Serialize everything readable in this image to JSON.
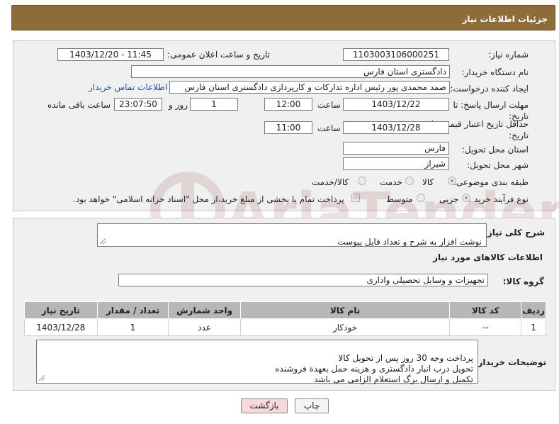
{
  "header": {
    "title": "جزئیات اطلاعات نیاز"
  },
  "form": {
    "need_number": {
      "label": "شماره نیاز:",
      "value": "1103003106000251"
    },
    "announce": {
      "label": "تاریخ و ساعت اعلان عمومی:",
      "value": "1403/12/20 - 11:45"
    },
    "buyer_org": {
      "label": "نام دستگاه خریدار:",
      "value": "دادگستری استان فارس"
    },
    "requester": {
      "label": "ایجاد کننده درخواست:",
      "value": "صمد محمدی پور رئیس اداره تدارکات و کارپردازی دادگستری استان فارس",
      "contact_link": "اطلاعات تماس خریدار"
    },
    "reply_deadline": {
      "label": "مهلت ارسال پاسخ: تا تاریخ:",
      "date": "1403/12/22",
      "time_label": "ساعت",
      "time": "12:00",
      "days": "1",
      "days_label": "روز و",
      "remaining": "23:07:50",
      "remaining_label": "ساعت باقی مانده"
    },
    "price_validity": {
      "label": "حداقل تاریخ اعتبار قیمت: تا تاریخ:",
      "date": "1403/12/28",
      "time_label": "ساعت",
      "time": "11:00"
    },
    "delivery_province": {
      "label": "استان محل تحویل:",
      "value": "فارس"
    },
    "delivery_city": {
      "label": "شهر محل تحویل:",
      "value": "شیراز"
    },
    "category": {
      "label": "طبقه بندی موضوعی:",
      "options": [
        "کالا",
        "خدمت",
        "کالا/خدمت"
      ],
      "selected": "کالا"
    },
    "process": {
      "label": "نوع فرآیند خرید :",
      "options": [
        "جزیی",
        "متوسط"
      ],
      "selected": "جزیی",
      "treasury_note": "پرداخت تمام یا بخشی از مبلغ خرید،از محل \"اسناد خزانه اسلامی\" خواهد بود."
    }
  },
  "details": {
    "summary_label": "شرح کلی نیاز:",
    "summary_value": "نوشت افزار به شرح و تعداد فایل پیوست",
    "goods_info_title": "اطلاعات کالاهای مورد نیاز",
    "goods_group_label": "گروه کالا:",
    "goods_group_value": "تجهیزات و وسایل تحصیلی واداری",
    "table": {
      "headers": [
        "ردیف",
        "کد کالا",
        "نام کالا",
        "واحد شمارش",
        "تعداد / مقدار",
        "تاریخ نیاز"
      ],
      "rows": [
        [
          "1",
          "--",
          "خودکار",
          "عدد",
          "1",
          "1403/12/28"
        ]
      ]
    },
    "buyer_notes_label": "توضیحات خریدار:",
    "buyer_notes": "پرداخت وجه 30 روز پس از تحویل کالا\nتحویل درب انبار دادگستری و هزینه حمل بعهدة فروشنده\nتکمیل و ارسال برگ استعلام الزامی می باشد"
  },
  "buttons": {
    "print": "چاپ",
    "back": "بازگشت"
  },
  "watermark": {
    "text": "AriaTender.neT"
  },
  "colors": {
    "header_bg": "#8e6c3a",
    "table_header_bg": "#b7b7b7",
    "back_button_bg": "#f6dada",
    "link": "#1a4fb5"
  }
}
